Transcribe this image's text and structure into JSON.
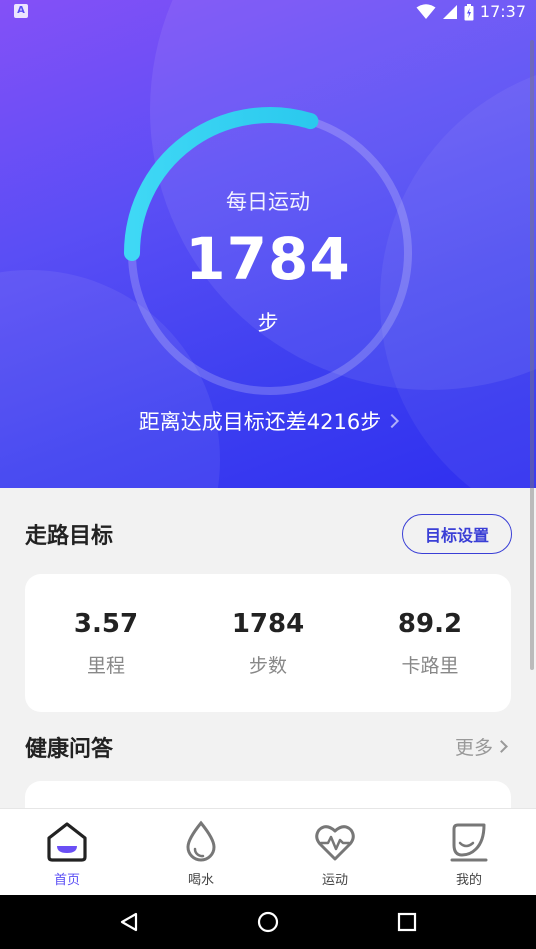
{
  "status_bar": {
    "time": "17:37",
    "app_icon_letter": "A"
  },
  "hero": {
    "title": "每日运动",
    "steps": "1784",
    "unit": "步",
    "goal_remaining": "距离达成目标还差4216步",
    "progress": 0.2973
  },
  "walking_goal": {
    "title": "走路目标",
    "settings_button": "目标设置",
    "stats": [
      {
        "value": "3.57",
        "label": "里程"
      },
      {
        "value": "1784",
        "label": "步数"
      },
      {
        "value": "89.2",
        "label": "卡路里"
      }
    ]
  },
  "health_qa": {
    "title": "健康问答",
    "more": "更多"
  },
  "tabs": [
    {
      "label": "首页",
      "icon": "home-icon",
      "active": true
    },
    {
      "label": "喝水",
      "icon": "water-drop-icon",
      "active": false
    },
    {
      "label": "运动",
      "icon": "heartbeat-icon",
      "active": false
    },
    {
      "label": "我的",
      "icon": "profile-icon",
      "active": false
    }
  ],
  "colors": {
    "accent": "#5a4ef5",
    "gauge_start": "#3ce0f0",
    "gauge_end": "#2ec8f2",
    "button_border": "#3a3fd6"
  }
}
